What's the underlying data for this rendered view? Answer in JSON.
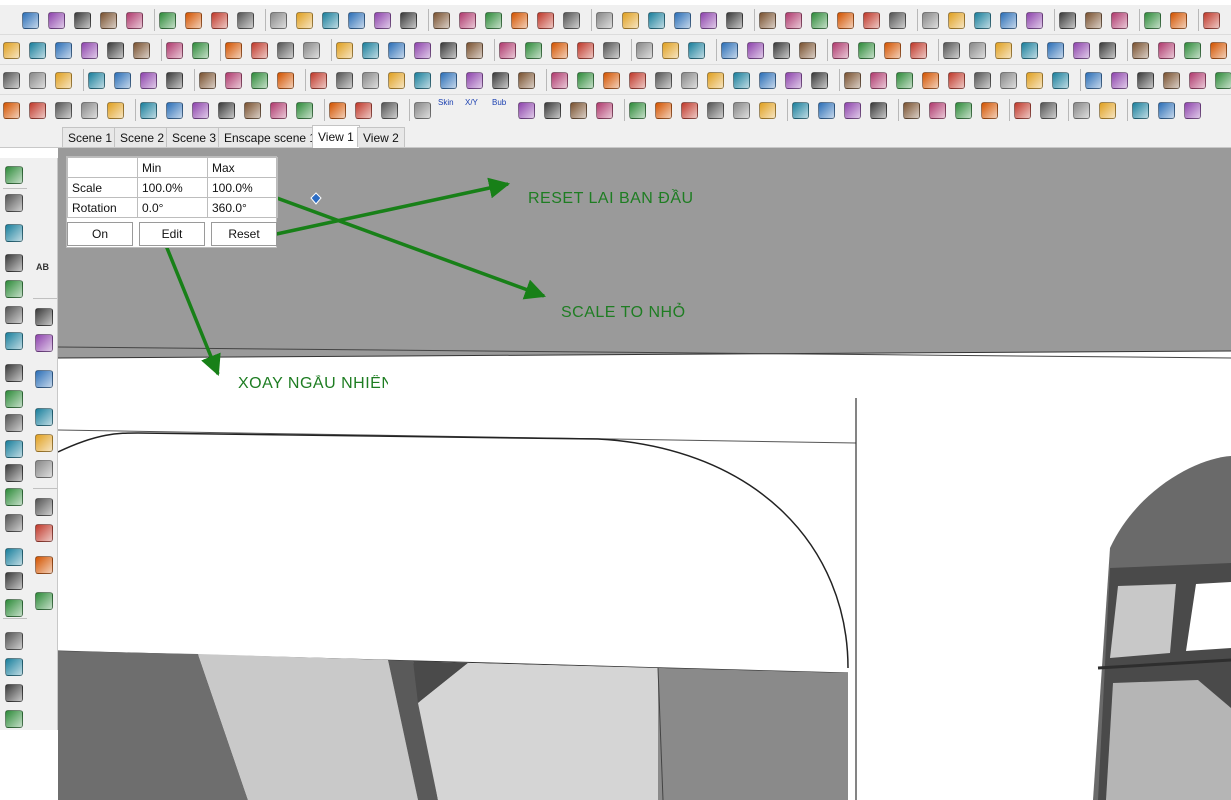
{
  "scene_tabs": [
    {
      "label": "Scene 1"
    },
    {
      "label": "Scene 2"
    },
    {
      "label": "Scene 3"
    },
    {
      "label": "Enscape scene 1"
    },
    {
      "label": "View 1",
      "active": true
    },
    {
      "label": "View 2"
    }
  ],
  "random_panel": {
    "col_min": "Min",
    "col_max": "Max",
    "rows": [
      {
        "label": "Scale",
        "min": "100.0%",
        "max": "100.0%"
      },
      {
        "label": "Rotation",
        "min": "0.0°",
        "max": "360.0°"
      }
    ],
    "buttons": {
      "on": "On",
      "edit": "Edit",
      "reset": "Reset"
    }
  },
  "annotations": {
    "reset": "RESET LAI BAN ĐẦU",
    "scale": "SCALE TO NHỎ",
    "rotate": "XOAY NGẪU NHIÊN"
  },
  "toolbar_text_icons": {
    "skin": "Skin",
    "xyz": "X/Y",
    "bub": "Bub",
    "ab": "AB"
  },
  "colors": {
    "toolbar_bg": "#f0f0f0",
    "annotation_green": "#1e7d22",
    "arrow_green": "#188018",
    "sky_gray": "#9a9a9a",
    "wall_dark": "#6e6e6e",
    "wall_light": "#c9c9c9",
    "snap_marker": "#2b6cc4"
  }
}
